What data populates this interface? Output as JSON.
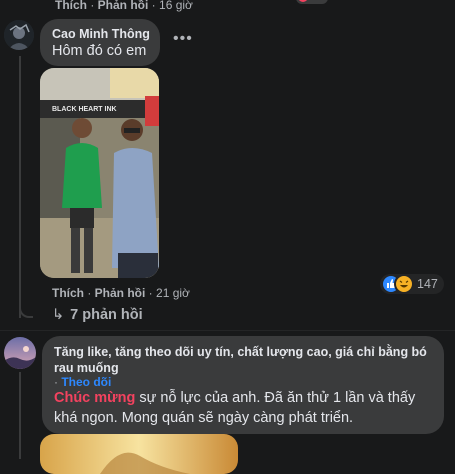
{
  "top_meta": {
    "like_label": "Thích",
    "reply_label": "Phản hồi",
    "time": "16 giờ"
  },
  "comment1": {
    "author": "Cao Minh Thông",
    "text": "Hôm đó có em",
    "photo_sign_text": "BLACK HEART INK",
    "like_label": "Thích",
    "reply_label": "Phản hồi",
    "time": "21 giờ",
    "reaction_count": "147",
    "replies_link": "7 phản hồi"
  },
  "comment2": {
    "author": "Tăng like, tăng theo dõi uy tín, chất lượng cao, giá chỉ bằng bó rau muống",
    "follow_label": "Theo dõi",
    "highlight": "Chúc mừng",
    "text": " sự nỗ lực của anh. Đã ăn thử 1 lần và thấy khá ngon. Mong quán sẽ ngày càng phát triển."
  },
  "colors": {
    "background": "#18191a",
    "bubble": "#3a3b3c",
    "highlight": "#f3425f",
    "link": "#2d88ff",
    "meta": "#b0b3b8"
  },
  "icons": [
    "more-dots-icon",
    "reply-arrow-icon",
    "like-reaction-icon",
    "haha-reaction-icon"
  ]
}
